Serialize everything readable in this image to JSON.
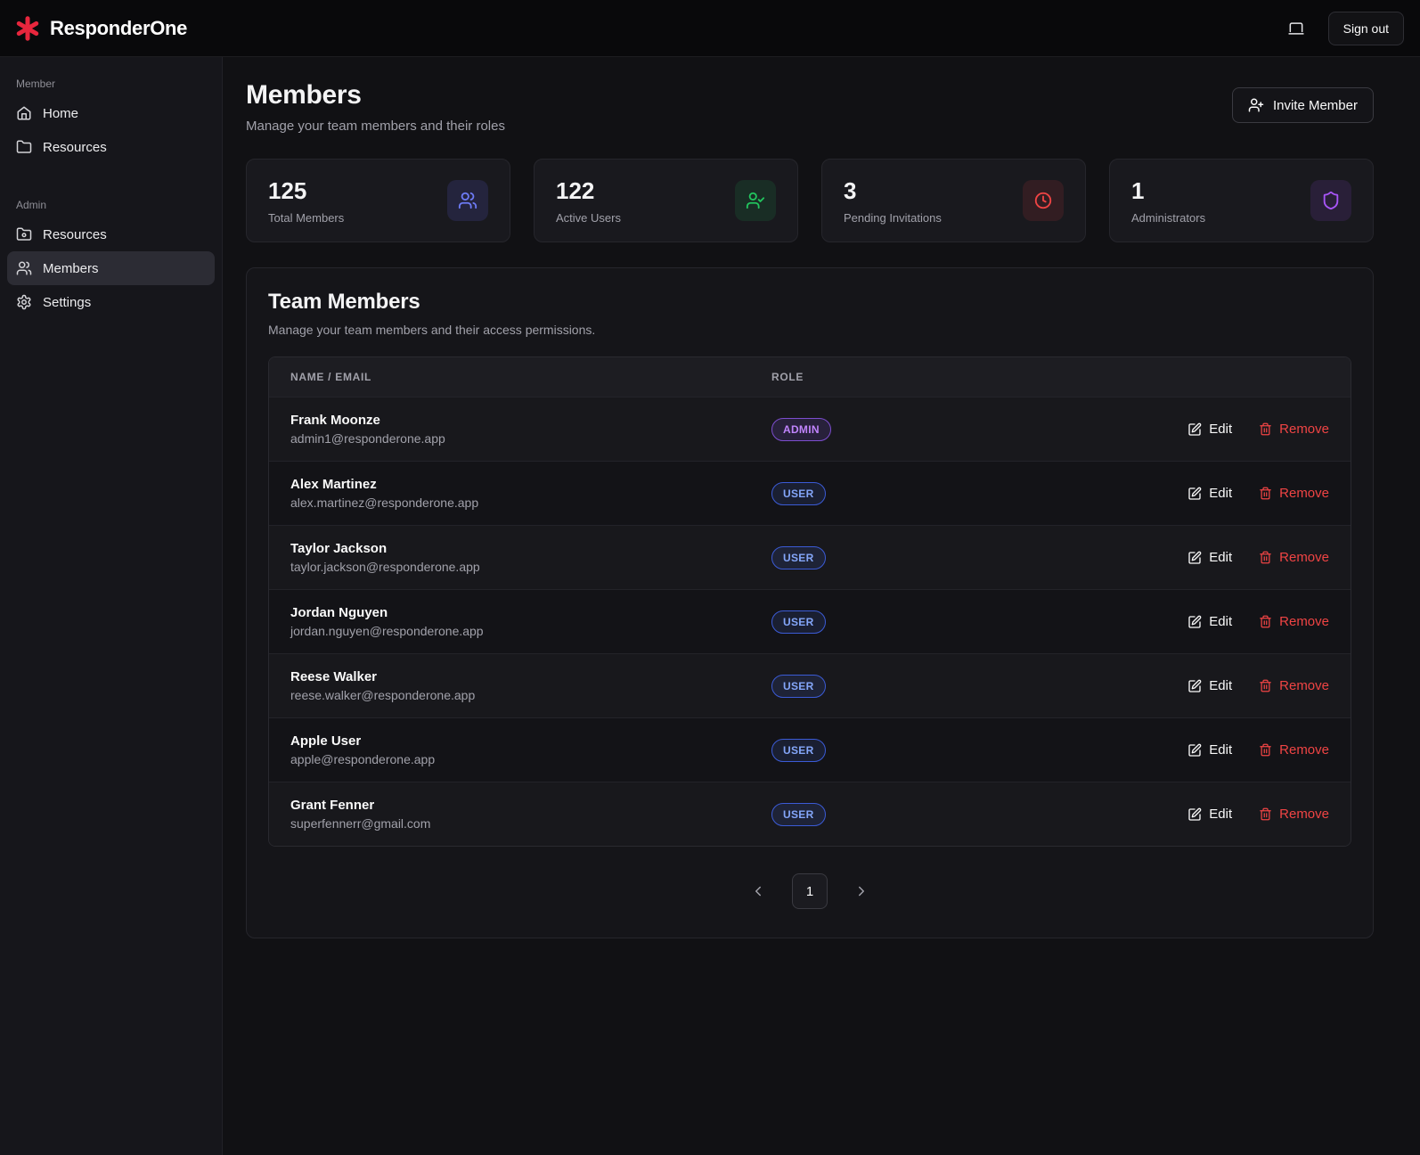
{
  "topbar": {
    "brand": "ResponderOne",
    "sign_out": "Sign out"
  },
  "sidebar": {
    "sections": [
      {
        "label": "Member",
        "items": [
          {
            "label": "Home",
            "icon": "home-icon"
          },
          {
            "label": "Resources",
            "icon": "folder-icon"
          }
        ]
      },
      {
        "label": "Admin",
        "items": [
          {
            "label": "Resources",
            "icon": "folder-cog-icon"
          },
          {
            "label": "Members",
            "icon": "users-icon",
            "active": true
          },
          {
            "label": "Settings",
            "icon": "gear-icon"
          }
        ]
      }
    ]
  },
  "header": {
    "title": "Members",
    "subtitle": "Manage your team members and their roles",
    "invite_button": "Invite Member"
  },
  "stats": [
    {
      "value": "125",
      "label": "Total Members",
      "icon": "users-icon",
      "color": "#6d7bf5"
    },
    {
      "value": "122",
      "label": "Active Users",
      "icon": "user-check-icon",
      "color": "#22c55e"
    },
    {
      "value": "3",
      "label": "Pending Invitations",
      "icon": "clock-icon",
      "color": "#ef4444"
    },
    {
      "value": "1",
      "label": "Administrators",
      "icon": "shield-icon",
      "color": "#a855f7"
    }
  ],
  "team": {
    "title": "Team Members",
    "subtitle": "Manage your team members and their access permissions.",
    "columns": {
      "name_email": "NAME / EMAIL",
      "role": "ROLE"
    },
    "edit_label": "Edit",
    "remove_label": "Remove",
    "members": [
      {
        "name": "Frank Moonze",
        "email": "admin1@responderone.app",
        "role": "ADMIN"
      },
      {
        "name": "Alex Martinez",
        "email": "alex.martinez@responderone.app",
        "role": "USER"
      },
      {
        "name": "Taylor Jackson",
        "email": "taylor.jackson@responderone.app",
        "role": "USER"
      },
      {
        "name": "Jordan Nguyen",
        "email": "jordan.nguyen@responderone.app",
        "role": "USER"
      },
      {
        "name": "Reese Walker",
        "email": "reese.walker@responderone.app",
        "role": "USER"
      },
      {
        "name": "Apple User",
        "email": "apple@responderone.app",
        "role": "USER"
      },
      {
        "name": "Grant Fenner",
        "email": "superfennerr@gmail.com",
        "role": "USER"
      }
    ],
    "pagination": {
      "current_page": "1"
    }
  },
  "colors": {
    "brand_red": "#e8263d",
    "admin_badge": "#c084fc",
    "user_badge": "#84a6f9",
    "remove_red": "#ef4444"
  }
}
